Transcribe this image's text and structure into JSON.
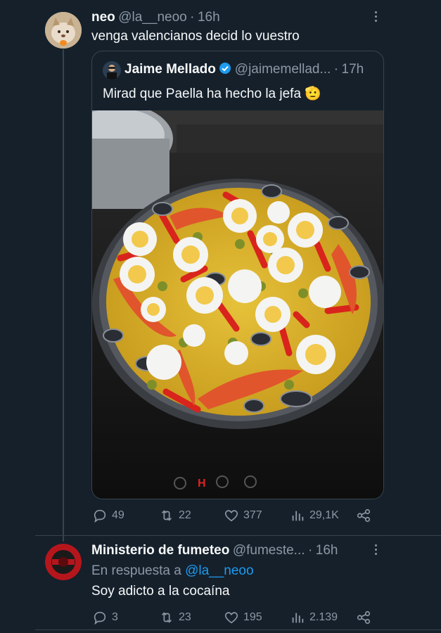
{
  "tweet": {
    "name": "neo",
    "handle": "@la__neoo",
    "sep": "·",
    "time": "16h",
    "text": "venga valencianos decid lo vuestro",
    "quote": {
      "name": "Jaime Mellado",
      "handle": "@jaimemellad...",
      "sep": "·",
      "time": "17h",
      "text": "Mirad que Paella ha hecho la jefa",
      "emoji": "🫡"
    },
    "actions": {
      "replies": "49",
      "retweets": "22",
      "likes": "377",
      "views": "29,1K"
    }
  },
  "reply": {
    "name": "Ministerio de fumeteo",
    "handle": "@fumeste...",
    "sep": "·",
    "time": "16h",
    "reply_to_prefix": "En respuesta a",
    "reply_to": "@la__neoo",
    "text": "Soy adicto a la cocaína",
    "actions": {
      "replies": "3",
      "retweets": "23",
      "likes": "195",
      "views": "2.139"
    }
  },
  "colors": {
    "background": "#15202b",
    "accent": "#1d9bf0",
    "muted": "#8b98a5",
    "verified": "#1d9bf0"
  },
  "icons": [
    "reply-icon",
    "retweet-icon",
    "like-icon",
    "views-icon",
    "share-icon",
    "verified-badge-icon",
    "more-icon"
  ]
}
